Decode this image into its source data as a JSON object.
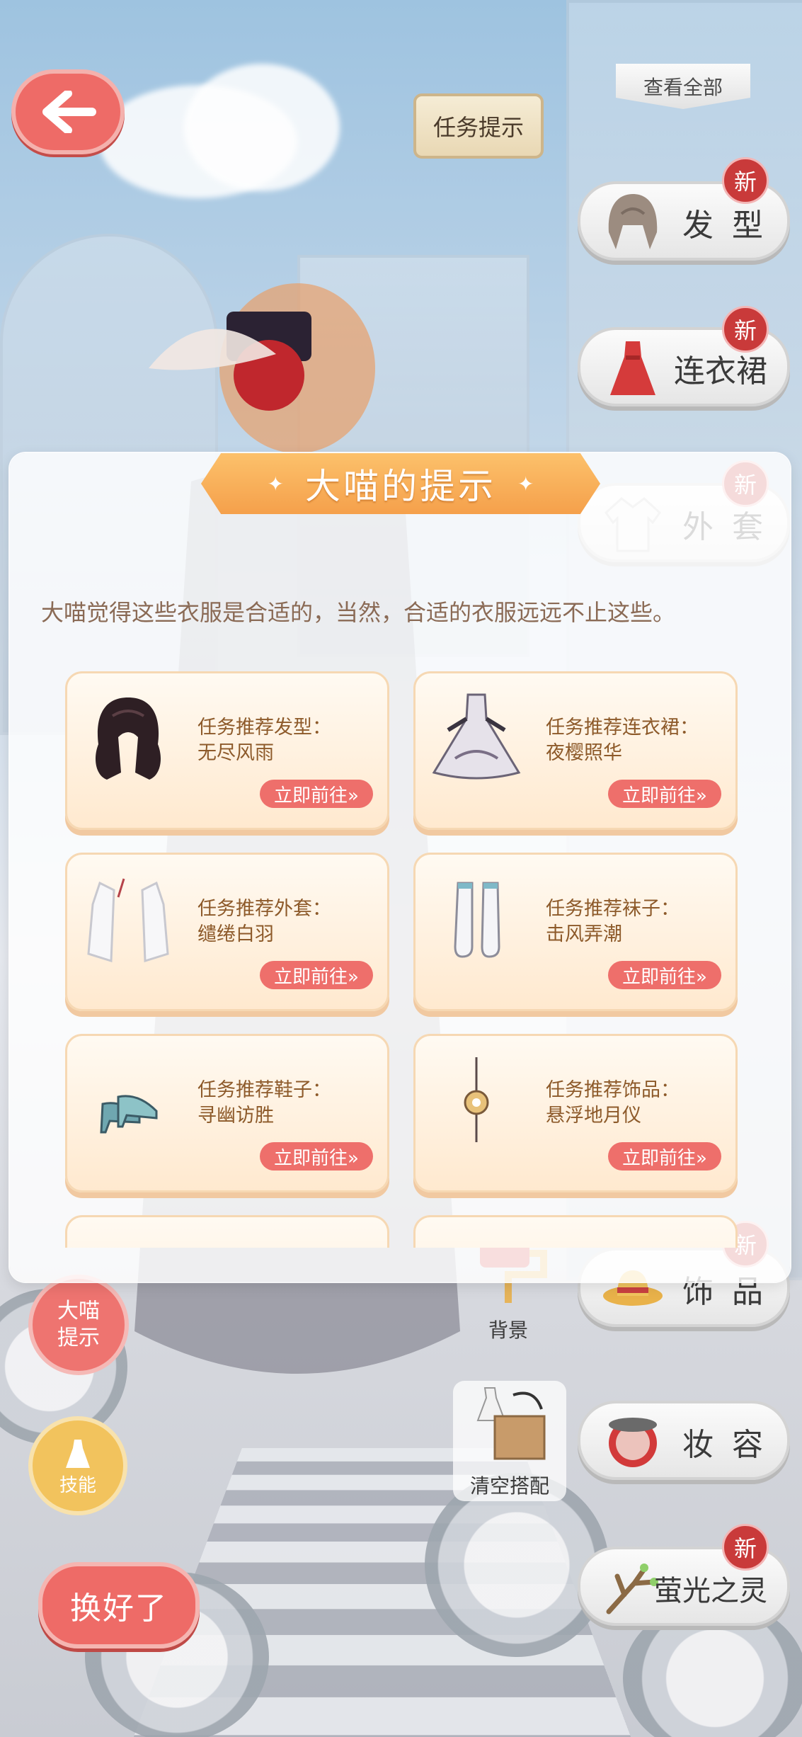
{
  "header": {
    "task_hint_label": "任务提示",
    "view_all_label": "查看全部"
  },
  "categories": [
    {
      "label": "发 型",
      "new": "新"
    },
    {
      "label": "连衣裙",
      "new": "新"
    },
    {
      "label": "外 套",
      "new": "新"
    },
    {
      "label": "饰 品",
      "new": "新"
    },
    {
      "label": "妆 容"
    },
    {
      "label": "萤光之灵",
      "new": "新"
    }
  ],
  "side": {
    "hint_label": "大喵提示",
    "skill_label": "技能",
    "done_label": "换好了",
    "background_label": "背景",
    "clear_label": "清空搭配"
  },
  "dialog": {
    "title": "大喵的提示",
    "description": "大喵觉得这些衣服是合适的，当然，合适的衣服远远不止这些。",
    "go_label": "立即前往»",
    "cards": [
      {
        "line1": "任务推荐发型：",
        "line2": "无尽风雨",
        "icon": "hair-icon"
      },
      {
        "line1": "任务推荐连衣裙：",
        "line2": "夜樱照华",
        "icon": "dress-icon"
      },
      {
        "line1": "任务推荐外套：",
        "line2": "缱绻白羽",
        "icon": "coat-icon"
      },
      {
        "line1": "任务推荐袜子：",
        "line2": "击风弄潮",
        "icon": "socks-icon"
      },
      {
        "line1": "任务推荐鞋子：",
        "line2": "寻幽访胜",
        "icon": "shoes-icon"
      },
      {
        "line1": "任务推荐饰品：",
        "line2": "悬浮地月仪",
        "icon": "accessory-icon"
      }
    ]
  },
  "colors": {
    "accent_red": "#ee6b67",
    "banner_orange": "#f5a04b",
    "card_text": "#8d5a2a"
  }
}
